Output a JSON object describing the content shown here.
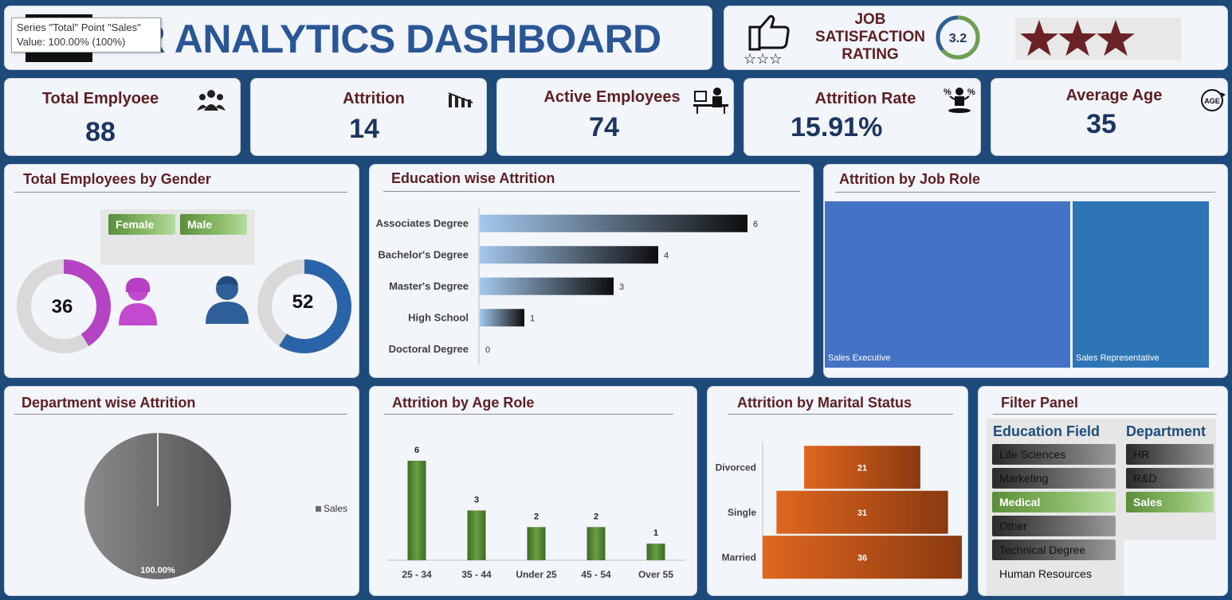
{
  "tooltip": {
    "line1": "Series \"Total\" Point \"Sales\"",
    "line2": "Value: 100.00% (100%)"
  },
  "header": {
    "title": "HR ANALYTICS DASHBOARD"
  },
  "job_satisfaction": {
    "label_line1": "JOB",
    "label_line2": "SATISFACTION",
    "label_line3": "RATING",
    "rating": "3.2",
    "rating_fraction": 0.64,
    "stars_filled": 3
  },
  "kpis": [
    {
      "label": "Total Emplyoee",
      "value": "88"
    },
    {
      "label": "Attrition",
      "value": "14"
    },
    {
      "label": "Active Employees",
      "value": "74"
    },
    {
      "label": "Attrition Rate",
      "value": "15.91%"
    },
    {
      "label": "Average Age",
      "value": "35"
    }
  ],
  "gender": {
    "title": "Total Employees by Gender",
    "filter_female": "Female",
    "filter_male": "Male",
    "female_value": "36",
    "male_value": "52",
    "female_fraction": 0.41,
    "male_fraction": 0.59,
    "colors": {
      "female": "#b544c4",
      "male": "#2a64a8",
      "track": "#d9d9d9"
    }
  },
  "education": {
    "title": "Education wise Attrition",
    "chart_data": {
      "type": "bar",
      "orientation": "horizontal",
      "categories": [
        "Associates Degree",
        "Bachelor's Degree",
        "Master's Degree",
        "High School",
        "Doctoral Degree"
      ],
      "values": [
        6,
        4,
        3,
        1,
        0
      ],
      "xlim": [
        0,
        6
      ]
    }
  },
  "jobrole": {
    "title": "Attrition by Job Role",
    "chart_data": {
      "type": "treemap",
      "categories": [
        "Sales Executive",
        "Sales Representative"
      ],
      "colors": [
        "#4472c4",
        "#2e75b6"
      ]
    }
  },
  "department": {
    "title": "Department wise Attrition",
    "chart_data": {
      "type": "pie",
      "categories": [
        "Sales"
      ],
      "values": [
        100
      ],
      "labels": [
        "100.00%"
      ],
      "legend": "right"
    }
  },
  "age": {
    "title": "Attrition by Age Role",
    "chart_data": {
      "type": "bar",
      "categories": [
        "25 - 34",
        "35 - 44",
        "Under 25",
        "45 - 54",
        "Over 55"
      ],
      "values": [
        6,
        3,
        2,
        2,
        1
      ],
      "ylim": [
        0,
        6
      ]
    }
  },
  "marital": {
    "title": "Attrition by Marital Status",
    "chart_data": {
      "type": "bar",
      "orientation": "funnel",
      "categories": [
        "Divorced",
        "Single",
        "Married"
      ],
      "values": [
        21,
        31,
        36
      ]
    }
  },
  "filter": {
    "title": "Filter Panel",
    "education_title": "Education Field",
    "department_title": "Department",
    "education_items": [
      "Life Sciences",
      "Marketing",
      "Medical",
      "Other",
      "Technical Degree",
      "Human Resources"
    ],
    "education_selected": "Medical",
    "department_items": [
      "HR",
      "R&D",
      "Sales"
    ],
    "department_selected": "Sales"
  }
}
